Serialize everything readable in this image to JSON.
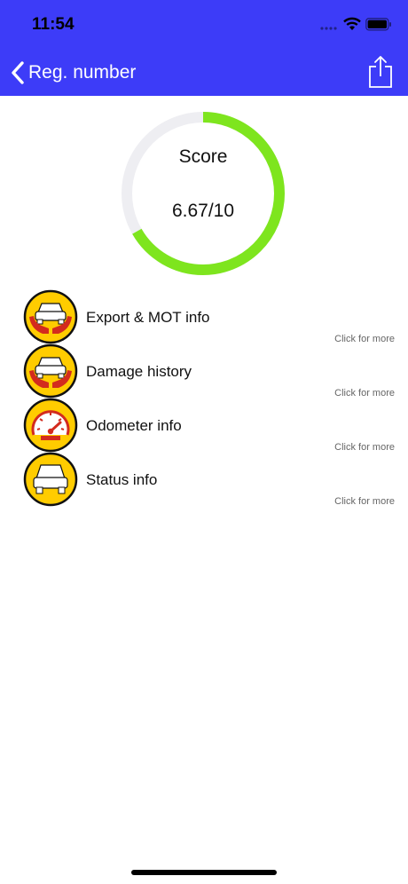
{
  "status_bar": {
    "time": "11:54"
  },
  "nav": {
    "back_label": "Reg. number"
  },
  "score": {
    "label": "Score",
    "value_text": "6.67/10",
    "value": 6.67,
    "max": 10,
    "color": "#7ee51e",
    "track_color": "#eeeef2"
  },
  "items": [
    {
      "label": "Export & MOT info",
      "more": "Click for more",
      "icon": "car-hands-icon"
    },
    {
      "label": "Damage history",
      "more": "Click for more",
      "icon": "car-hands-icon"
    },
    {
      "label": "Odometer info",
      "more": "Click for more",
      "icon": "speedometer-icon"
    },
    {
      "label": "Status info",
      "more": "Click for more",
      "icon": "car-icon"
    }
  ],
  "colors": {
    "header": "#3d3cf8",
    "icon_fill": "#ffcc00",
    "icon_hands": "#d32b1e"
  }
}
